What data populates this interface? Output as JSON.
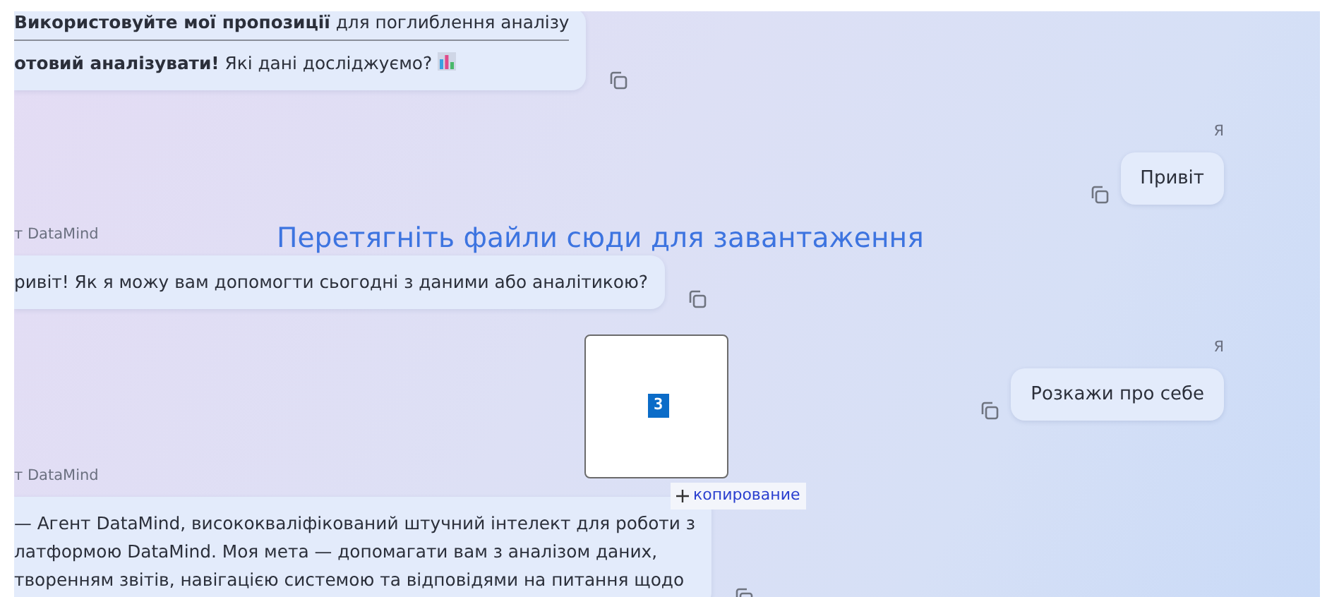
{
  "drop_hint": "Перетягніть файли сюди для завантаження",
  "messages": [
    {
      "kind": "agent",
      "lines": [
        "**Використовуйте мої пропозиції** для поглиблення аналізу",
        "**отовий аналізувати!** Які дані досліджуємо?"
      ],
      "divider": true,
      "chart_emoji": true
    },
    {
      "kind": "user",
      "sender": "Я",
      "lines": [
        "Привіт"
      ]
    },
    {
      "kind": "agent",
      "sender": "т DataMind",
      "lines": [
        "ривіт! Як я можу вам допомогти сьогодні з даними або аналітикою?"
      ]
    },
    {
      "kind": "user",
      "sender": "Я",
      "lines": [
        "Розкажи про себе"
      ]
    },
    {
      "kind": "agent",
      "sender": "т DataMind",
      "lines": [
        "— Агент DataMind, висококваліфікований штучний інтелект для роботи з",
        "латформою DataMind. Моя мета — допомагати вам з аналізом даних,",
        "творенням звітів, навігацією системою та відповідями на питання щодо"
      ]
    }
  ],
  "drag_preview": {
    "count": "3",
    "tooltip": "копирование"
  }
}
